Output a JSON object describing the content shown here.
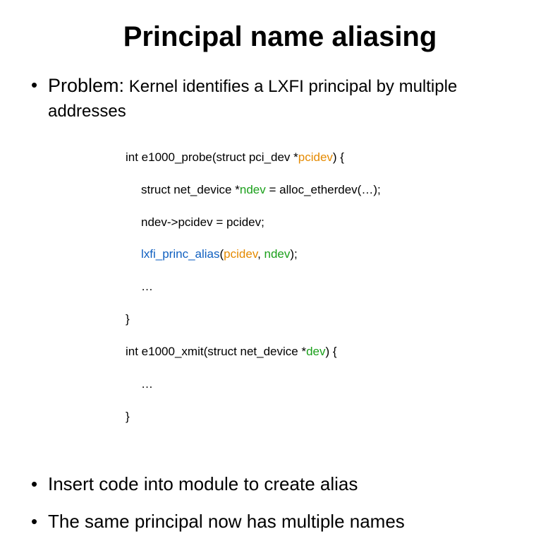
{
  "title": "Principal name aliasing",
  "bullets": {
    "b1_label": "Problem:",
    "b1_rest": " Kernel identifies a LXFI principal by multiple addresses",
    "b2": "Insert code into module to create alias",
    "b3": "The same principal now has multiple names"
  },
  "code": {
    "l1a": "int e1000_probe(struct pci_dev *",
    "l1b": "pcidev",
    "l1c": ") {",
    "l2a": "struct net_device *",
    "l2b": "ndev",
    "l2c": " = alloc_etherdev(…);",
    "l3": "ndev->pcidev = pcidev;",
    "l4a": "lxfi_princ_alias",
    "l4b": "(",
    "l4c": "pcidev",
    "l4d": ", ",
    "l4e": "ndev",
    "l4f": ");",
    "l5": "…",
    "l6": "}",
    "l7a": "int e1000_xmit(struct net_device *",
    "l7b": "dev",
    "l7c": ") {",
    "l8": "…",
    "l9": "}"
  }
}
